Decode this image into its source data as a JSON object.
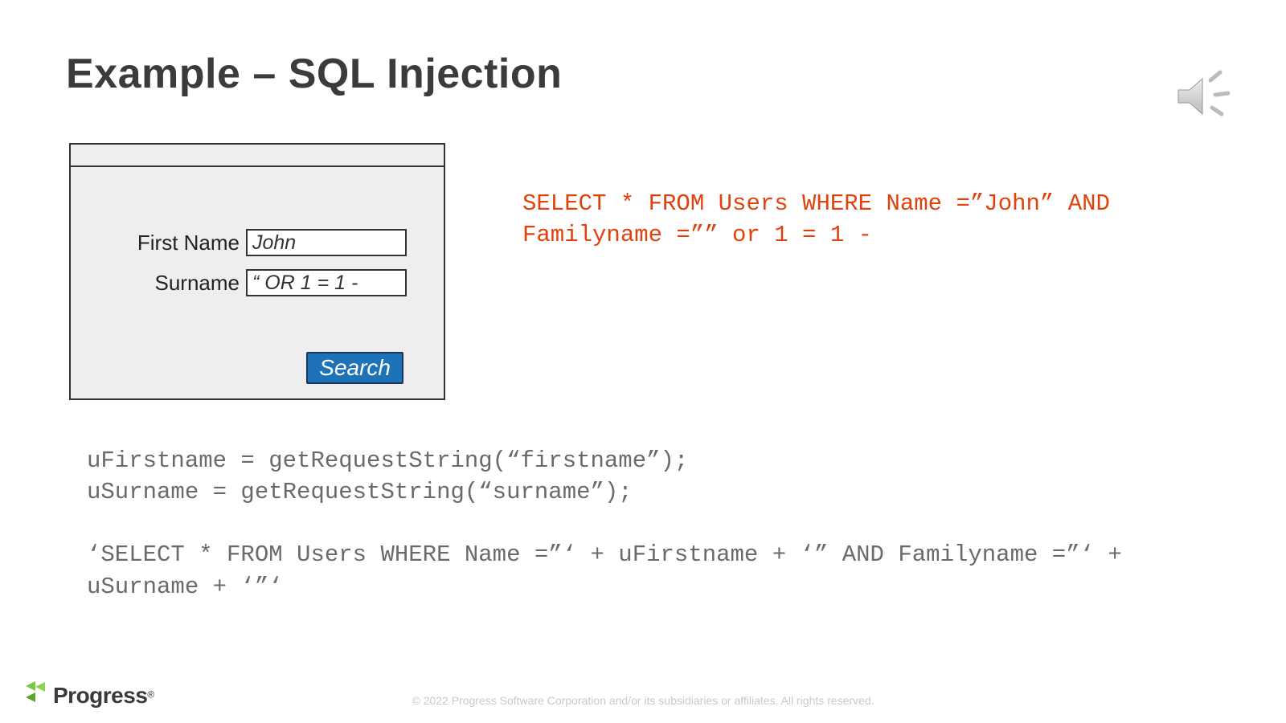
{
  "title": "Example – SQL Injection",
  "form": {
    "firstNameLabel": "First Name",
    "surnameLabel": "Surname",
    "firstNameValue": "John",
    "surnameValue": "“ OR 1 = 1 -",
    "searchLabel": "Search"
  },
  "result": "SELECT * FROM Users WHERE Name =”John” AND Familyname =”” or 1 = 1 -",
  "code": "uFirstname = getRequestString(“firstname”);\nuSurname = getRequestString(“surname”);\n\n‘SELECT * FROM Users WHERE Name =”‘ + uFirstname + ‘” AND Familyname =”‘ + uSurname + ‘”‘",
  "footer": "© 2022 Progress Software Corporation and/or its subsidiaries or affiliates. All rights reserved.",
  "logo": {
    "text": "Progress"
  }
}
